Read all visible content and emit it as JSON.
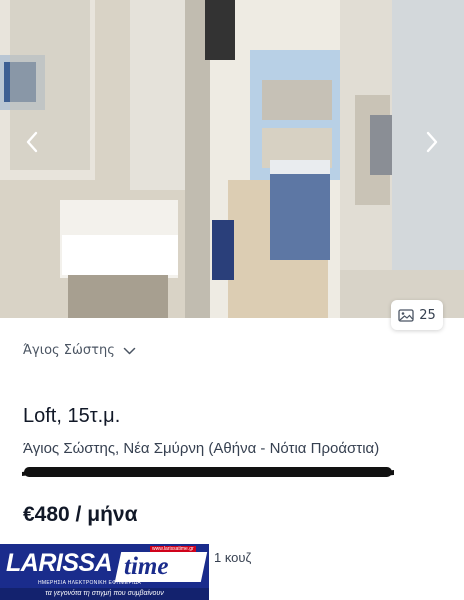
{
  "gallery": {
    "photo_count": "25",
    "prev_icon": "chevron-left-icon",
    "next_icon": "chevron-right-icon",
    "count_icon": "image-icon"
  },
  "location_filter": {
    "label": "Άγιος Σώστης",
    "icon": "chevron-down-icon"
  },
  "listing": {
    "title": "Loft, 15τ.μ.",
    "address": "Άγιος Σώστης, Νέα Σμύρνη (Αθήνα - Νότια Προάστια)",
    "price": "€480 / μήνα",
    "bathrooms": "1 κουζ",
    "bathroom_icon": "door-icon"
  },
  "watermark": {
    "brand_left": "LARISSA",
    "brand_right": "time",
    "url": "www.larissatime.gr",
    "subtitle": "ΗΜΕΡΗΣΙΑ ΗΛΕΚΤΡΟΝΙΚΗ ΕΦΗΜΕΡΙΔΑ",
    "slogan": "τα γεγονότα τη στιγμή που συμβαίνουν"
  },
  "colors": {
    "accent_blue": "#1a2c8c",
    "logo_red": "#d0021b"
  }
}
